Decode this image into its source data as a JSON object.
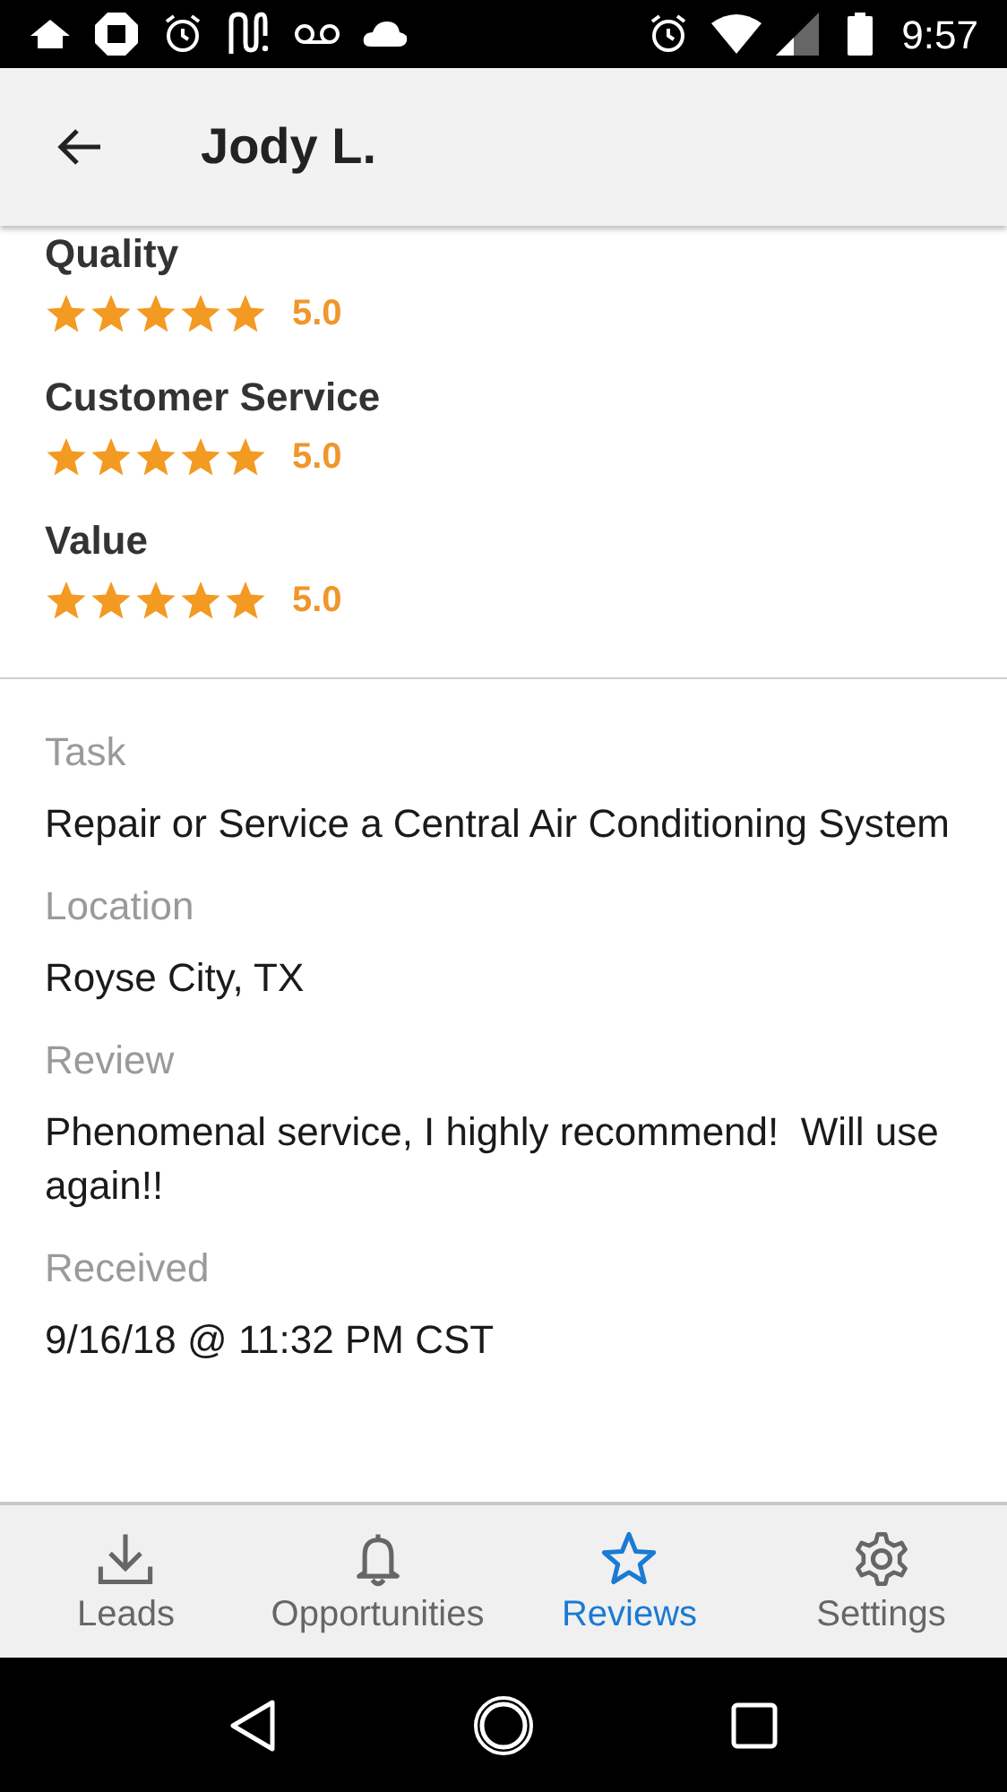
{
  "status_bar": {
    "time": "9:57"
  },
  "header": {
    "title": "Jody L."
  },
  "ratings": [
    {
      "label": "Quality",
      "stars": 5,
      "score": "5.0"
    },
    {
      "label": "Customer Service",
      "stars": 5,
      "score": "5.0"
    },
    {
      "label": "Value",
      "stars": 5,
      "score": "5.0"
    }
  ],
  "details": [
    {
      "label": "Task",
      "value": "Repair or Service a Central Air Conditioning System"
    },
    {
      "label": "Location",
      "value": "Royse City, TX"
    },
    {
      "label": "Review",
      "value": "Phenomenal service, I highly recommend!  Will use again!!"
    },
    {
      "label": "Received",
      "value": "9/16/18 @ 11:32 PM CST"
    }
  ],
  "tabs": [
    {
      "kind": "download",
      "label": "Leads",
      "selected": false
    },
    {
      "kind": "bell",
      "label": "Opportunities",
      "selected": false
    },
    {
      "kind": "star",
      "label": "Reviews",
      "selected": true
    },
    {
      "kind": "gear",
      "label": "Settings",
      "selected": false
    }
  ]
}
